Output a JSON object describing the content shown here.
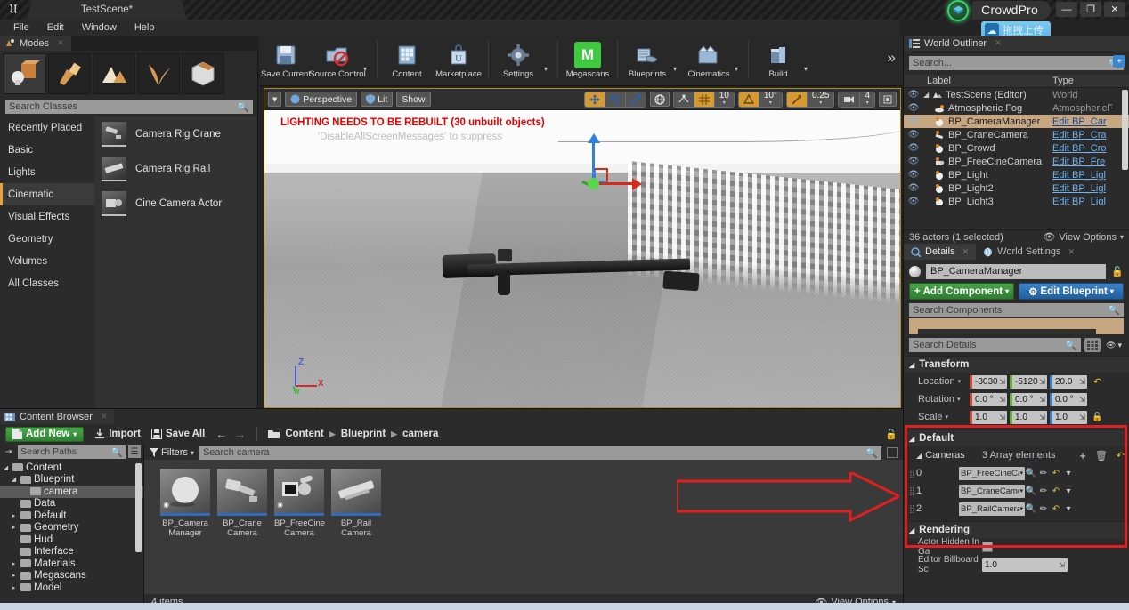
{
  "titlebar": {
    "scene_tab": "TestScene*",
    "brand": "CrowdPro",
    "upload_tooltip": "拖拽上传",
    "min": "—",
    "max": "❐",
    "close": "✕"
  },
  "menubar": {
    "items": [
      "File",
      "Edit",
      "Window",
      "Help"
    ]
  },
  "modes": {
    "tab_label": "Modes",
    "search_placeholder": "Search Classes",
    "mode_icons": [
      "place-mode-icon",
      "paint-mode-icon",
      "landscape-mode-icon",
      "foliage-mode-icon",
      "geometry-mode-icon"
    ],
    "categories": [
      "Recently Placed",
      "Basic",
      "Lights",
      "Cinematic",
      "Visual Effects",
      "Geometry",
      "Volumes",
      "All Classes"
    ],
    "selected_category": "Cinematic",
    "assets": [
      {
        "label": "Camera Rig Crane"
      },
      {
        "label": "Camera Rig Rail"
      },
      {
        "label": "Cine Camera Actor"
      }
    ]
  },
  "toolbar": {
    "items": [
      {
        "label": "Save Current",
        "icon": "save-icon",
        "caret": false
      },
      {
        "label": "Source Control",
        "icon": "source-control-icon",
        "caret": true
      },
      {
        "label": "Content",
        "icon": "content-icon",
        "caret": false
      },
      {
        "label": "Marketplace",
        "icon": "marketplace-icon",
        "caret": false
      },
      {
        "label": "Settings",
        "icon": "settings-icon",
        "caret": true
      },
      {
        "label": "Megascans",
        "icon": "megascans-icon",
        "caret": false
      },
      {
        "label": "Blueprints",
        "icon": "blueprints-icon",
        "caret": true
      },
      {
        "label": "Cinematics",
        "icon": "cinematics-icon",
        "caret": true
      },
      {
        "label": "Build",
        "icon": "build-icon",
        "caret": true
      }
    ],
    "megascans_glyph": "M",
    "overflow": "»"
  },
  "viewport": {
    "view_mode_caret": "▾",
    "perspective": "Perspective",
    "lit": "Lit",
    "show": "Show",
    "grid_snap_value": "10",
    "angle_snap_value": "10°",
    "scale_snap_value": "0.25",
    "camera_speed_value": "4",
    "warning_line1": "LIGHTING NEEDS TO BE REBUILT (30 unbuilt objects)",
    "warning_line2": "'DisableAllScreenMessages' to suppress",
    "axis_labels": {
      "x": "X",
      "y": "Y",
      "z": "Z"
    }
  },
  "outliner": {
    "tab_label": "World Outliner",
    "search_placeholder": "Search...",
    "col_label": "Label",
    "col_type": "Type",
    "rows": [
      {
        "label": "TestScene (Editor)",
        "type": "World",
        "link": false,
        "indent": 0,
        "selected": false
      },
      {
        "label": "Atmospheric Fog",
        "type": "AtmosphericF",
        "link": false,
        "indent": 1,
        "selected": false
      },
      {
        "label": "BP_CameraManager",
        "type": "Edit BP_Car",
        "link": true,
        "indent": 1,
        "selected": true
      },
      {
        "label": "BP_CraneCamera",
        "type": "Edit BP_Cra",
        "link": true,
        "indent": 1,
        "selected": false
      },
      {
        "label": "BP_Crowd",
        "type": "Edit BP_Cro",
        "link": true,
        "indent": 1,
        "selected": false
      },
      {
        "label": "BP_FreeCineCamera",
        "type": "Edit BP_Fre",
        "link": true,
        "indent": 1,
        "selected": false
      },
      {
        "label": "BP_Light",
        "type": "Edit BP_Ligl",
        "link": true,
        "indent": 1,
        "selected": false
      },
      {
        "label": "BP_Light2",
        "type": "Edit BP_Ligl",
        "link": true,
        "indent": 1,
        "selected": false
      },
      {
        "label": "BP_Light3",
        "type": "Edit BP_Ligl",
        "link": true,
        "indent": 1,
        "selected": false
      }
    ],
    "status": "36 actors (1 selected)",
    "view_options": "View Options"
  },
  "details": {
    "tab_details": "Details",
    "tab_world_settings": "World Settings",
    "actor_name": "BP_CameraManager",
    "add_component": "Add Component",
    "edit_blueprint": "Edit Blueprint",
    "search_components_placeholder": "Search Components",
    "search_details_placeholder": "Search Details",
    "transform": {
      "title": "Transform",
      "rows": [
        {
          "label": "Location",
          "values": [
            "-3030",
            "-5120",
            "20.0"
          ]
        },
        {
          "label": "Rotation",
          "values": [
            "0.0 °",
            "0.0 °",
            "0.0 °"
          ]
        },
        {
          "label": "Scale",
          "values": [
            "1.0",
            "1.0",
            "1.0"
          ]
        }
      ]
    },
    "default": {
      "title": "Default",
      "array_label": "Cameras",
      "array_count": "3 Array elements",
      "elements": [
        {
          "index": "0",
          "value": "BP_FreeCineCa"
        },
        {
          "index": "1",
          "value": "BP_CraneCame"
        },
        {
          "index": "2",
          "value": "BP_RailCamera"
        }
      ]
    },
    "rendering": {
      "title": "Rendering",
      "rows": [
        {
          "label": "Actor Hidden In Ga",
          "type": "checkbox",
          "value": ""
        },
        {
          "label": "Editor Billboard Sc",
          "type": "text",
          "value": "1.0"
        }
      ]
    }
  },
  "content_browser": {
    "tab_label": "Content Browser",
    "add_new": "Add New",
    "import": "Import",
    "save_all": "Save All",
    "breadcrumbs": [
      "Content",
      "Blueprint",
      "camera"
    ],
    "paths_search_placeholder": "Search Paths",
    "filters_label": "Filters",
    "assets_search_placeholder": "Search camera",
    "tree": [
      {
        "label": "Content",
        "indent": 0,
        "tri": "▾",
        "selected": false
      },
      {
        "label": "Blueprint",
        "indent": 1,
        "tri": "▾",
        "selected": false
      },
      {
        "label": "camera",
        "indent": 2,
        "tri": "",
        "selected": true
      },
      {
        "label": "Data",
        "indent": 1,
        "tri": "",
        "selected": false
      },
      {
        "label": "Default",
        "indent": 1,
        "tri": "▸",
        "selected": false
      },
      {
        "label": "Geometry",
        "indent": 1,
        "tri": "▸",
        "selected": false
      },
      {
        "label": "Hud",
        "indent": 1,
        "tri": "",
        "selected": false
      },
      {
        "label": "Interface",
        "indent": 1,
        "tri": "",
        "selected": false
      },
      {
        "label": "Materials",
        "indent": 1,
        "tri": "▸",
        "selected": false
      },
      {
        "label": "Megascans",
        "indent": 1,
        "tri": "▸",
        "selected": false
      },
      {
        "label": "Model",
        "indent": 1,
        "tri": "▸",
        "selected": false
      }
    ],
    "tiles": [
      {
        "line1": "BP_Camera",
        "line2": "Manager",
        "star": true
      },
      {
        "line1": "BP_Crane",
        "line2": "Camera",
        "star": false
      },
      {
        "line1": "BP_FreeCine",
        "line2": "Camera",
        "star": true
      },
      {
        "line1": "BP_Rail",
        "line2": "Camera",
        "star": false
      }
    ],
    "item_count": "4 items",
    "view_options": "View Options"
  },
  "annotation": {
    "arrow_color": "#e02020",
    "box_color": "#e02020"
  }
}
